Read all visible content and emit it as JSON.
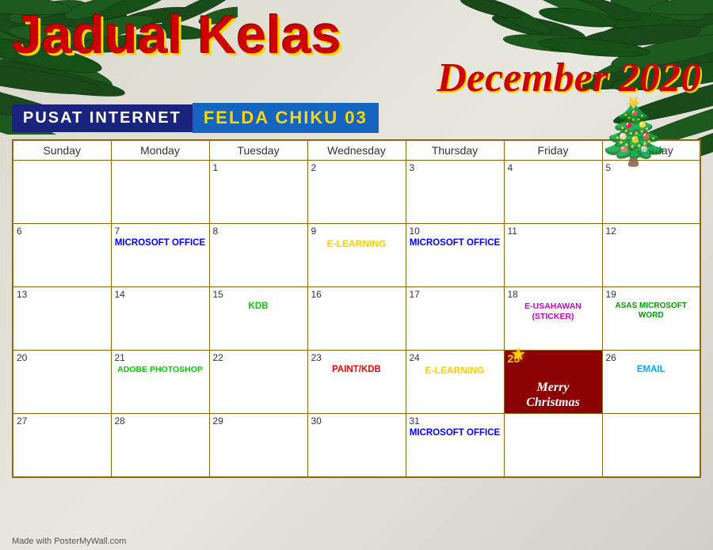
{
  "title": {
    "line1": "Jadual Kelas",
    "line2": "December 2020"
  },
  "badge": {
    "left": "PUSAT INTERNET",
    "right": "FELDA CHIKU 03"
  },
  "days": [
    "Sunday",
    "Monday",
    "Tuesday",
    "Wednesday",
    "Thursday",
    "Friday",
    "Saturday"
  ],
  "weeks": [
    [
      {
        "num": "",
        "event": "",
        "cls": ""
      },
      {
        "num": "",
        "event": "",
        "cls": ""
      },
      {
        "num": "1",
        "event": "",
        "cls": ""
      },
      {
        "num": "2",
        "event": "",
        "cls": ""
      },
      {
        "num": "3",
        "event": "",
        "cls": ""
      },
      {
        "num": "4",
        "event": "",
        "cls": ""
      },
      {
        "num": "5",
        "event": "",
        "cls": ""
      }
    ],
    [
      {
        "num": "6",
        "event": "",
        "cls": ""
      },
      {
        "num": "7",
        "event": "MICROSOFT OFFICE",
        "cls": "ev-microsoft"
      },
      {
        "num": "8",
        "event": "",
        "cls": ""
      },
      {
        "num": "9",
        "event": "E-LEARNING",
        "cls": "ev-elearning"
      },
      {
        "num": "10",
        "event": "MICROSOFT OFFICE",
        "cls": "ev-microsoft"
      },
      {
        "num": "11",
        "event": "",
        "cls": ""
      },
      {
        "num": "12",
        "event": "",
        "cls": ""
      }
    ],
    [
      {
        "num": "13",
        "event": "",
        "cls": ""
      },
      {
        "num": "14",
        "event": "",
        "cls": ""
      },
      {
        "num": "15",
        "event": "KDB",
        "cls": "ev-kdb"
      },
      {
        "num": "16",
        "event": "",
        "cls": ""
      },
      {
        "num": "17",
        "event": "",
        "cls": ""
      },
      {
        "num": "18",
        "event": "E-USAHAWAN (STICKER)",
        "cls": "ev-eusahawan"
      },
      {
        "num": "19",
        "event": "ASAS MICROSOFT WORD",
        "cls": "ev-asas"
      }
    ],
    [
      {
        "num": "20",
        "event": "",
        "cls": ""
      },
      {
        "num": "21",
        "event": "ADOBE PHOTOSHOP",
        "cls": "ev-adobe"
      },
      {
        "num": "22",
        "event": "",
        "cls": ""
      },
      {
        "num": "23",
        "event": "PAINT/KDB",
        "cls": "ev-paintkdb"
      },
      {
        "num": "24",
        "event": "E-LEARNING",
        "cls": "ev-elearning"
      },
      {
        "num": "25",
        "event": "christmas",
        "cls": "christmas"
      },
      {
        "num": "26",
        "event": "EMAIL",
        "cls": "ev-email"
      }
    ],
    [
      {
        "num": "27",
        "event": "",
        "cls": ""
      },
      {
        "num": "28",
        "event": "",
        "cls": ""
      },
      {
        "num": "29",
        "event": "",
        "cls": ""
      },
      {
        "num": "30",
        "event": "",
        "cls": ""
      },
      {
        "num": "31",
        "event": "MICROSOFT OFFICE",
        "cls": "ev-microsoft"
      },
      {
        "num": "",
        "event": "",
        "cls": ""
      },
      {
        "num": "",
        "event": "",
        "cls": ""
      }
    ]
  ],
  "christmas": {
    "text1": "Merry",
    "text2": "Christmas"
  },
  "footer": "Made with PosterMyWall.com"
}
